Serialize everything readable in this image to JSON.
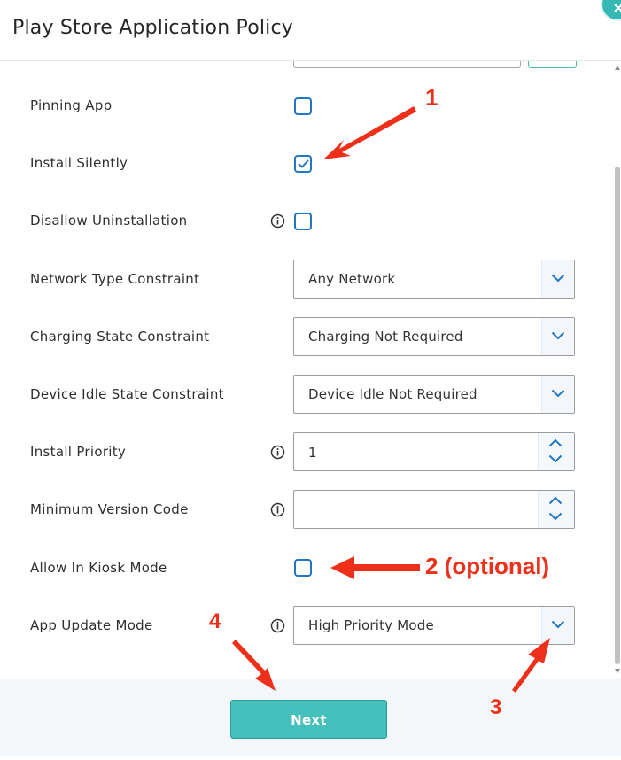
{
  "header": {
    "title": "Play Store Application Policy"
  },
  "icons": {
    "close": "close-icon",
    "info": "info-icon",
    "dropdown": "chevron-down-icon",
    "spinner_up": "chevron-up-icon",
    "spinner_down": "chevron-down-icon",
    "check": "checkmark-icon"
  },
  "form": {
    "pinning_app": {
      "label": "Pinning App",
      "checked": false
    },
    "install_silently": {
      "label": "Install Silently",
      "checked": true
    },
    "disallow_uninstallation": {
      "label": "Disallow Uninstallation",
      "checked": false
    },
    "network_type_constraint": {
      "label": "Network Type Constraint",
      "value": "Any Network"
    },
    "charging_state_constraint": {
      "label": "Charging State Constraint",
      "value": "Charging Not Required"
    },
    "device_idle_state_constraint": {
      "label": "Device Idle State Constraint",
      "value": "Device Idle Not Required"
    },
    "install_priority": {
      "label": "Install Priority",
      "value": "1"
    },
    "minimum_version_code": {
      "label": "Minimum Version Code",
      "value": ""
    },
    "allow_in_kiosk_mode": {
      "label": "Allow In Kiosk Mode",
      "checked": false
    },
    "app_update_mode": {
      "label": "App Update Mode",
      "value": "High Priority Mode"
    }
  },
  "footer": {
    "next_label": "Next"
  },
  "annotations": {
    "label_1": "1",
    "label_2": "2 (optional)",
    "label_3": "3",
    "label_4": "4",
    "color": "#ee2f19"
  },
  "colors": {
    "accent": "#45c0bd",
    "checkbox_border": "#2277c4",
    "annotation": "#ee2f19"
  }
}
